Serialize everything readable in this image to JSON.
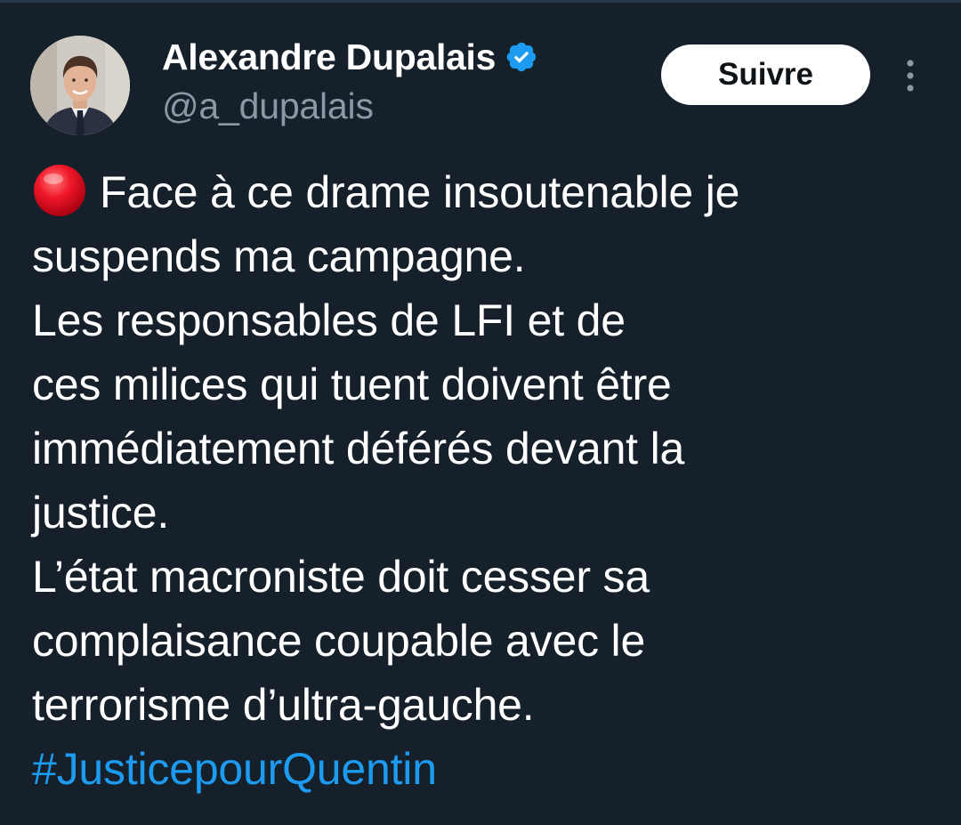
{
  "author": {
    "display_name": "Alexandre Dupalais",
    "handle": "@a_dupalais",
    "verified": true,
    "verified_icon": "verified-badge-icon",
    "avatar_icon": "profile-photo"
  },
  "actions": {
    "follow_label": "Suivre",
    "more_icon": "more-vertical-icon"
  },
  "tweet": {
    "leading_emoji": "red-circle-icon",
    "lines": [
      "Face à ce drame insoutenable je",
      "suspends ma campagne.",
      "Les responsables de LFI et de",
      "ces milices qui tuent doivent être",
      "immédiatement déférés devant la",
      "justice.",
      "L’état macroniste doit cesser sa",
      "complaisance coupable avec le",
      "terrorisme d’ultra-gauche."
    ],
    "hashtag": "#JusticepourQuentin"
  },
  "colors": {
    "background": "#15202b",
    "text": "#ffffff",
    "secondary_text": "#8b98a5",
    "link": "#1d9bf0",
    "verified": "#1d9bf0",
    "button_bg": "#ffffff",
    "button_text": "#0f1419"
  }
}
